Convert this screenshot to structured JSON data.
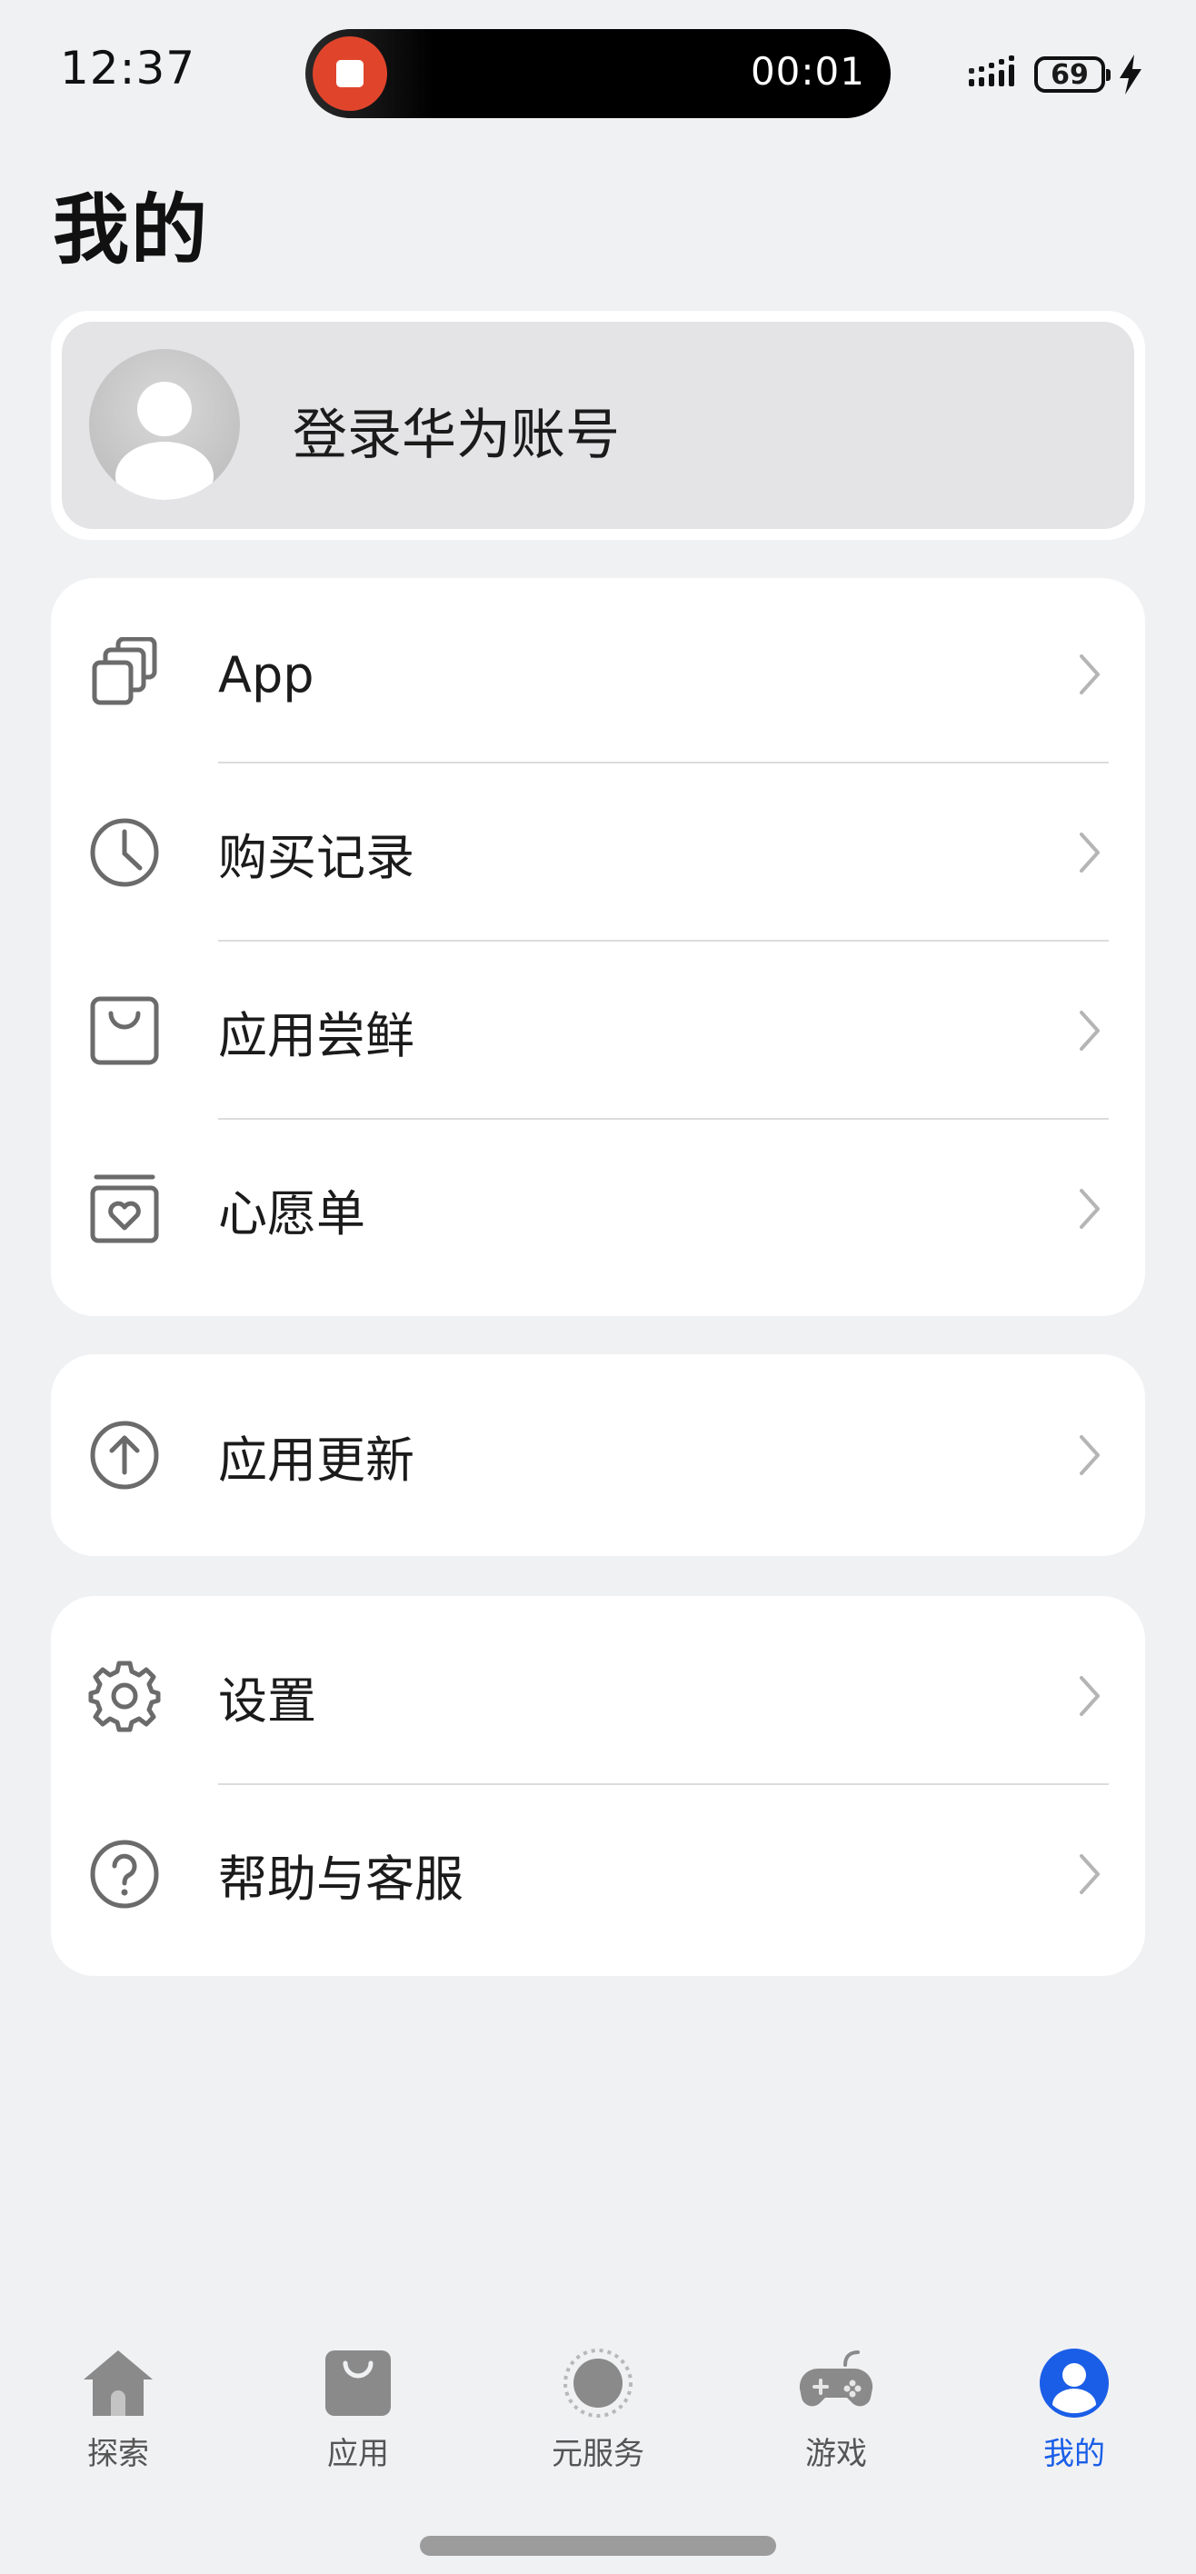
{
  "status_bar": {
    "time": "12:37",
    "recording_timer": "00:01",
    "battery": "69",
    "icons": [
      "stop-recording-icon",
      "signal-icon",
      "battery-icon",
      "charging-bolt-icon"
    ]
  },
  "page": {
    "title": "我的"
  },
  "account": {
    "login_label": "登录华为账号",
    "avatar_icon": "default-avatar-icon"
  },
  "menu_groups": [
    {
      "items": [
        {
          "label": "App",
          "icon": "apps-stack-icon"
        },
        {
          "label": "购买记录",
          "icon": "clock-icon"
        },
        {
          "label": "应用尝鲜",
          "icon": "shopping-bag-icon"
        },
        {
          "label": "心愿单",
          "icon": "wishlist-heart-icon"
        }
      ]
    },
    {
      "items": [
        {
          "label": "应用更新",
          "icon": "update-arrow-icon"
        }
      ]
    },
    {
      "items": [
        {
          "label": "设置",
          "icon": "gear-icon"
        },
        {
          "label": "帮助与客服",
          "icon": "help-question-icon"
        }
      ]
    }
  ],
  "bottom_nav": {
    "items": [
      {
        "label": "探索",
        "icon": "home-icon",
        "active": false
      },
      {
        "label": "应用",
        "icon": "app-bag-icon",
        "active": false
      },
      {
        "label": "元服务",
        "icon": "atomic-service-icon",
        "active": false
      },
      {
        "label": "游戏",
        "icon": "gamepad-icon",
        "active": false
      },
      {
        "label": "我的",
        "icon": "profile-icon",
        "active": true
      }
    ]
  },
  "colors": {
    "background": "#f0f1f3",
    "card": "#ffffff",
    "accent": "#1a5ee8",
    "record": "#e0452c",
    "icon_gray": "#6b6b6b"
  }
}
